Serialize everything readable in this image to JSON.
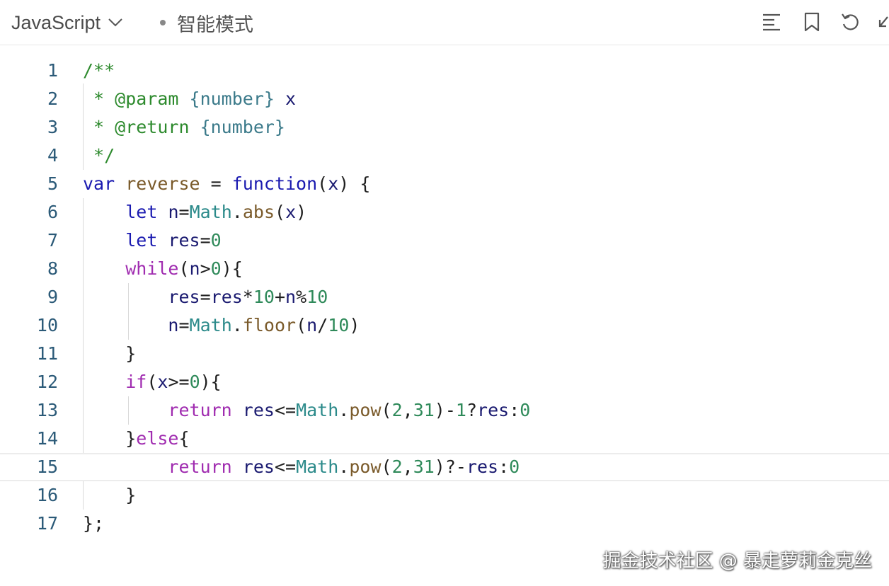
{
  "toolbar": {
    "language": "JavaScript",
    "mode": "智能模式",
    "icons": [
      "format-icon",
      "bookmark-icon",
      "undo-icon",
      "collapse-icon"
    ]
  },
  "editor": {
    "active_line": 15,
    "lines": [
      {
        "n": "1",
        "tokens": [
          [
            "c-comment",
            "/**"
          ]
        ]
      },
      {
        "n": "2",
        "tokens": [
          [
            "c-comment",
            " * @param "
          ],
          [
            "c-type",
            "{number}"
          ],
          [
            "c-var",
            " x"
          ]
        ]
      },
      {
        "n": "3",
        "tokens": [
          [
            "c-comment",
            " * @return "
          ],
          [
            "c-type",
            "{number}"
          ]
        ]
      },
      {
        "n": "4",
        "tokens": [
          [
            "c-comment",
            " */"
          ]
        ]
      },
      {
        "n": "5",
        "tokens": [
          [
            "c-kw",
            "var"
          ],
          [
            "c-punc",
            " "
          ],
          [
            "c-fn",
            "reverse"
          ],
          [
            "c-punc",
            " = "
          ],
          [
            "c-kw",
            "function"
          ],
          [
            "c-punc",
            "("
          ],
          [
            "c-var",
            "x"
          ],
          [
            "c-punc",
            ") {"
          ]
        ]
      },
      {
        "n": "6",
        "tokens": [
          [
            "c-punc",
            "    "
          ],
          [
            "c-kw",
            "let"
          ],
          [
            "c-punc",
            " "
          ],
          [
            "c-var",
            "n"
          ],
          [
            "c-punc",
            "="
          ],
          [
            "c-cls",
            "Math"
          ],
          [
            "c-punc",
            "."
          ],
          [
            "c-fn",
            "abs"
          ],
          [
            "c-punc",
            "("
          ],
          [
            "c-var",
            "x"
          ],
          [
            "c-punc",
            ")"
          ]
        ]
      },
      {
        "n": "7",
        "tokens": [
          [
            "c-punc",
            "    "
          ],
          [
            "c-kw",
            "let"
          ],
          [
            "c-punc",
            " "
          ],
          [
            "c-var",
            "res"
          ],
          [
            "c-punc",
            "="
          ],
          [
            "c-num",
            "0"
          ]
        ]
      },
      {
        "n": "8",
        "tokens": [
          [
            "c-punc",
            "    "
          ],
          [
            "c-ctrl",
            "while"
          ],
          [
            "c-punc",
            "("
          ],
          [
            "c-var",
            "n"
          ],
          [
            "c-punc",
            ">"
          ],
          [
            "c-num",
            "0"
          ],
          [
            "c-punc",
            "){"
          ]
        ]
      },
      {
        "n": "9",
        "tokens": [
          [
            "c-punc",
            "        "
          ],
          [
            "c-var",
            "res"
          ],
          [
            "c-punc",
            "="
          ],
          [
            "c-var",
            "res"
          ],
          [
            "c-punc",
            "*"
          ],
          [
            "c-num",
            "10"
          ],
          [
            "c-punc",
            "+"
          ],
          [
            "c-var",
            "n"
          ],
          [
            "c-punc",
            "%"
          ],
          [
            "c-num",
            "10"
          ]
        ]
      },
      {
        "n": "10",
        "tokens": [
          [
            "c-punc",
            "        "
          ],
          [
            "c-var",
            "n"
          ],
          [
            "c-punc",
            "="
          ],
          [
            "c-cls",
            "Math"
          ],
          [
            "c-punc",
            "."
          ],
          [
            "c-fn",
            "floor"
          ],
          [
            "c-punc",
            "("
          ],
          [
            "c-var",
            "n"
          ],
          [
            "c-punc",
            "/"
          ],
          [
            "c-num",
            "10"
          ],
          [
            "c-punc",
            ")"
          ]
        ]
      },
      {
        "n": "11",
        "tokens": [
          [
            "c-punc",
            "    }"
          ]
        ]
      },
      {
        "n": "12",
        "tokens": [
          [
            "c-punc",
            "    "
          ],
          [
            "c-ctrl",
            "if"
          ],
          [
            "c-punc",
            "("
          ],
          [
            "c-var",
            "x"
          ],
          [
            "c-punc",
            ">="
          ],
          [
            "c-num",
            "0"
          ],
          [
            "c-punc",
            "){"
          ]
        ]
      },
      {
        "n": "13",
        "tokens": [
          [
            "c-punc",
            "        "
          ],
          [
            "c-ctrl",
            "return"
          ],
          [
            "c-punc",
            " "
          ],
          [
            "c-var",
            "res"
          ],
          [
            "c-punc",
            "<="
          ],
          [
            "c-cls",
            "Math"
          ],
          [
            "c-punc",
            "."
          ],
          [
            "c-fn",
            "pow"
          ],
          [
            "c-punc",
            "("
          ],
          [
            "c-num",
            "2"
          ],
          [
            "c-punc",
            ","
          ],
          [
            "c-num",
            "31"
          ],
          [
            "c-punc",
            ")-"
          ],
          [
            "c-num",
            "1"
          ],
          [
            "c-punc",
            "?"
          ],
          [
            "c-var",
            "res"
          ],
          [
            "c-punc",
            ":"
          ],
          [
            "c-num",
            "0"
          ]
        ]
      },
      {
        "n": "14",
        "tokens": [
          [
            "c-punc",
            "    }"
          ],
          [
            "c-ctrl",
            "else"
          ],
          [
            "c-punc",
            "{"
          ]
        ]
      },
      {
        "n": "15",
        "tokens": [
          [
            "c-punc",
            "        "
          ],
          [
            "c-ctrl",
            "return"
          ],
          [
            "c-punc",
            " "
          ],
          [
            "c-var",
            "res"
          ],
          [
            "c-punc",
            "<="
          ],
          [
            "c-cls",
            "Math"
          ],
          [
            "c-punc",
            "."
          ],
          [
            "c-fn",
            "pow"
          ],
          [
            "c-punc",
            "("
          ],
          [
            "c-num",
            "2"
          ],
          [
            "c-punc",
            ","
          ],
          [
            "c-num",
            "31"
          ],
          [
            "c-punc",
            ")?-"
          ],
          [
            "c-var",
            "res"
          ],
          [
            "c-punc",
            ":"
          ],
          [
            "c-num",
            "0"
          ]
        ]
      },
      {
        "n": "16",
        "tokens": [
          [
            "c-punc",
            "    }"
          ]
        ]
      },
      {
        "n": "17",
        "tokens": [
          [
            "c-punc",
            "};"
          ]
        ]
      }
    ]
  },
  "watermark": "掘金技术社区 @ 暴走萝莉金克丝"
}
